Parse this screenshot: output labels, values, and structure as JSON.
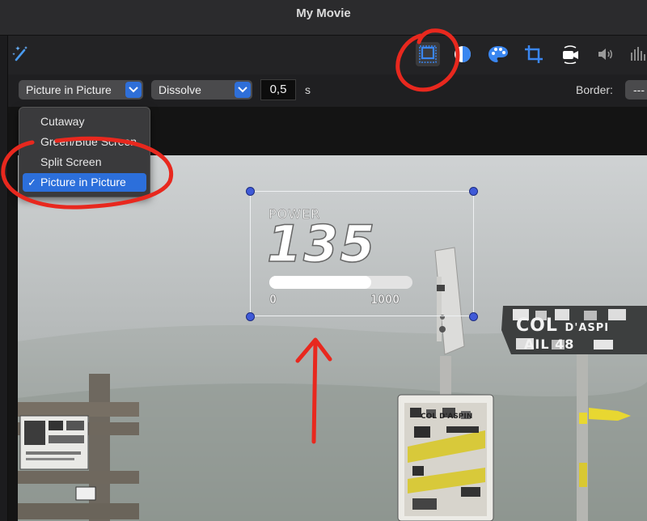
{
  "window": {
    "title": "My Movie"
  },
  "toolbar": {
    "icons": [
      "magic-wand-icon",
      "video-overlay-settings-icon",
      "color-balance-icon",
      "color-correction-icon",
      "crop-icon",
      "stabilization-icon",
      "volume-icon",
      "noise-reduction-icon"
    ]
  },
  "overlay": {
    "type_value": "Picture in Picture",
    "transition_value": "Dissolve",
    "duration_value": "0,5",
    "duration_unit": "s",
    "border_label": "Border:",
    "border_value": "---"
  },
  "menu": {
    "items": [
      {
        "label": "Cutaway",
        "checked": false
      },
      {
        "label": "Green/Blue Screen",
        "checked": false
      },
      {
        "label": "Split Screen",
        "checked": false
      },
      {
        "label": "Picture in Picture",
        "checked": true
      }
    ]
  },
  "pip": {
    "label": "POWER",
    "value": "135",
    "min": "0",
    "max": "1000",
    "fill_fraction": 0.71
  },
  "scene": {
    "sign_text_1": "COL",
    "sign_text_2": "D'ASPI",
    "sign_text_3": "AIL",
    "sign_text_4": "48",
    "board_text": "COL D'ASPIN"
  },
  "colors": {
    "accent": "#2c6fdb",
    "annotation": "#e8281e",
    "handle": "#3f5ad8"
  }
}
